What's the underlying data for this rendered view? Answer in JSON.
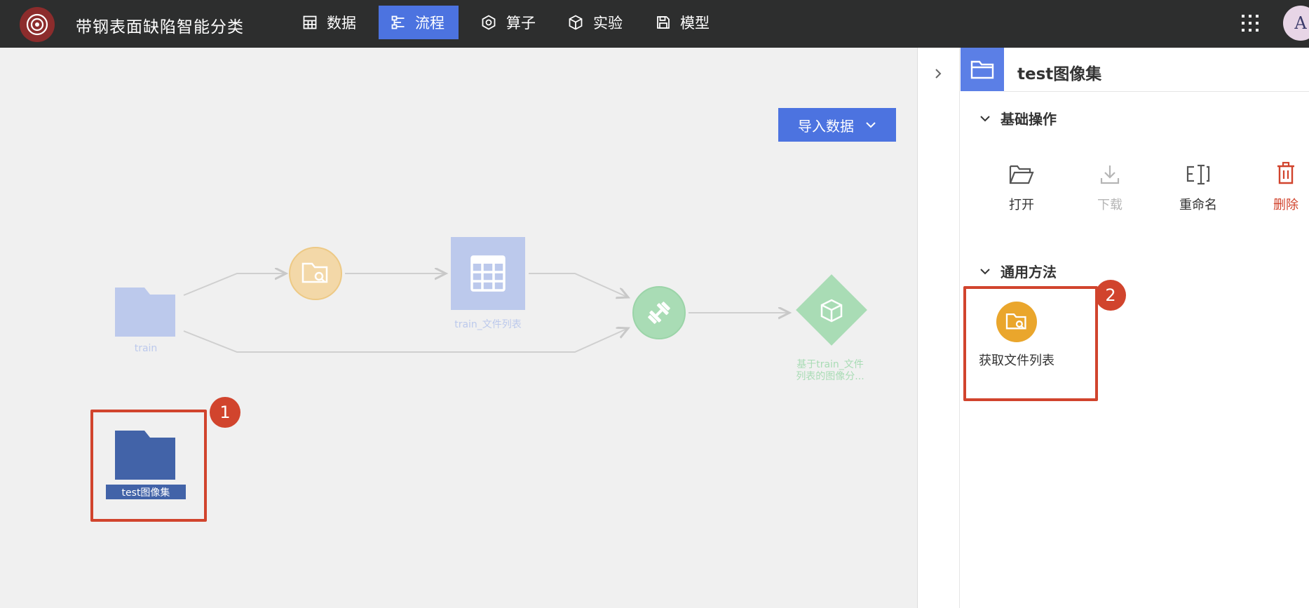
{
  "app": {
    "title": "带钢表面缺陷智能分类",
    "avatar_letter": "A"
  },
  "nav": [
    {
      "label": "数据",
      "icon": "table-icon",
      "active": false
    },
    {
      "label": "流程",
      "icon": "flow-icon",
      "active": true
    },
    {
      "label": "算子",
      "icon": "hexagon-icon",
      "active": false
    },
    {
      "label": "实验",
      "icon": "cube-icon",
      "active": false
    },
    {
      "label": "模型",
      "icon": "save-icon",
      "active": false
    }
  ],
  "toolbar": {
    "import_label": "导入数据"
  },
  "flow": {
    "nodes": {
      "train": "train",
      "file_list": "train_文件列表",
      "model_line1": "基于train_文件",
      "model_line2": "列表的图像分...",
      "test": "test图像集"
    }
  },
  "annotations": {
    "badge1": "1",
    "badge2": "2"
  },
  "panel": {
    "title": "test图像集",
    "basic_section": "基础操作",
    "ops": [
      {
        "label": "打开",
        "icon": "folder-open-icon",
        "enabled": true
      },
      {
        "label": "下载",
        "icon": "download-icon",
        "enabled": false
      },
      {
        "label": "重命名",
        "icon": "rename-icon",
        "enabled": true
      },
      {
        "label": "删除",
        "icon": "trash-icon",
        "enabled": true
      }
    ],
    "methods_section": "通用方法",
    "method": {
      "label": "获取文件列表",
      "icon": "folder-search-icon"
    }
  },
  "colors": {
    "accent": "#4c73e0",
    "topbar": "#2d2e2e",
    "highlight": "#d1442d",
    "method_orange": "#eaa62c",
    "delete_red": "#d1442d",
    "folder_blue": "#4263a8"
  }
}
